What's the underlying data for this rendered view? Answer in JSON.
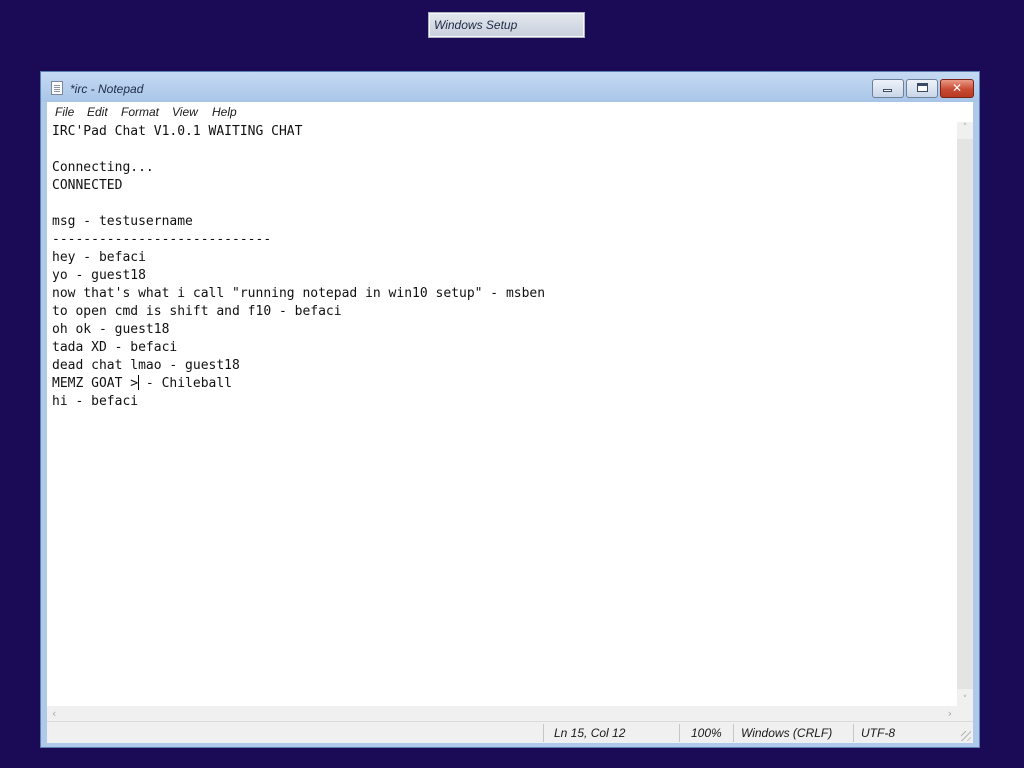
{
  "background": {
    "color": "#1b0b56",
    "setup_button_label": "Windows Setup"
  },
  "window": {
    "title": "*irc - Notepad",
    "icon": "notepad-icon",
    "controls": {
      "minimize": "minimize-icon",
      "maximize": "maximize-icon",
      "close_glyph": "✕"
    }
  },
  "menu": {
    "items": [
      {
        "label": "File"
      },
      {
        "label": "Edit"
      },
      {
        "label": "Format"
      },
      {
        "label": "View"
      },
      {
        "label": "Help"
      }
    ]
  },
  "editor": {
    "lines": [
      "IRC'Pad Chat V1.0.1 WAITING CHAT",
      "",
      "Connecting...",
      "CONNECTED",
      "",
      "msg - testusername",
      "----------------------------",
      "hey - befaci",
      "yo - guest18",
      "now that's what i call \"running notepad in win10 setup\" - msben",
      "to open cmd is shift and f10 - befaci",
      "oh ok - guest18",
      "tada XD - befaci",
      "dead chat lmao - guest18",
      "MEMZ GOAT >",
      "hi - befaci"
    ],
    "caret_line_rest": " - Chileball"
  },
  "scrollbars": {
    "up_arrow": "˄",
    "down_arrow": "˅",
    "left_arrow": "‹",
    "right_arrow": "›"
  },
  "statusbar": {
    "position": "Ln 15, Col 12",
    "zoom": "100%",
    "line_ending": "Windows (CRLF)",
    "encoding": "UTF-8"
  }
}
